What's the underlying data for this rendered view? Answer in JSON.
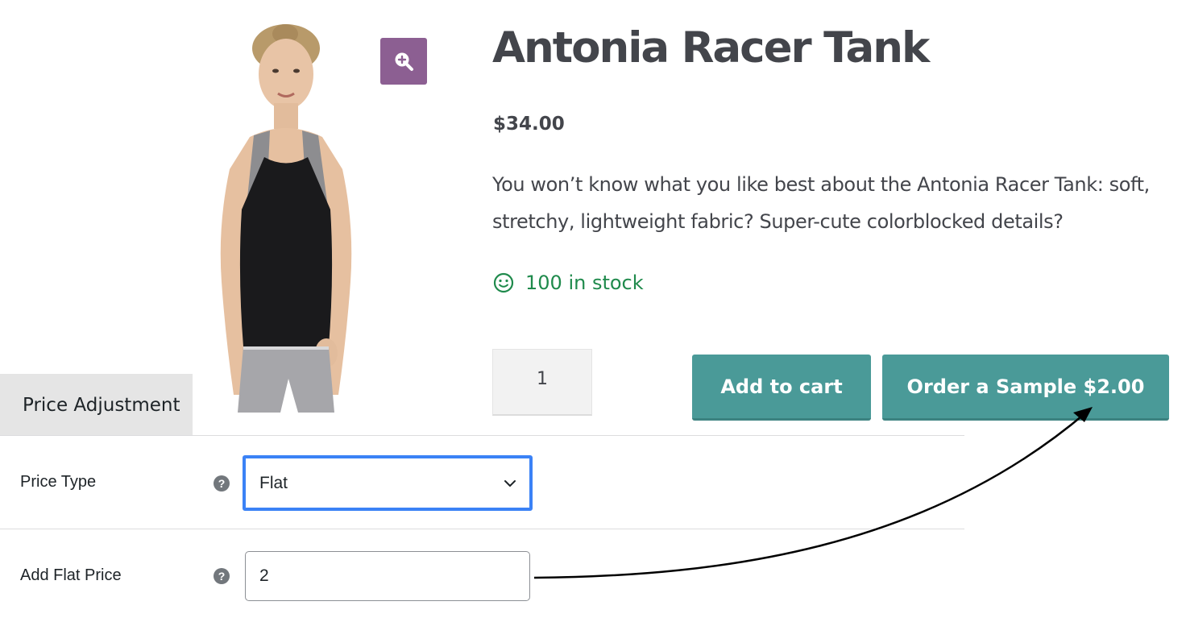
{
  "product": {
    "title": "Antonia Racer Tank",
    "price": "$34.00",
    "description": "You won’t know what you like best about the Antonia Racer Tank: soft, stretchy, lightweight fabric? Super-cute colorblocked details?",
    "stock_text": "100 in stock",
    "quantity": "1",
    "add_to_cart_label": "Add to cart",
    "order_sample_label": "Order a Sample $2.00",
    "zoom_icon": "zoom-in-icon"
  },
  "admin": {
    "tab_label": "Price Adjustment",
    "price_type_label": "Price Type",
    "price_type_value": "Flat",
    "flat_price_label": "Add Flat Price",
    "flat_price_value": "2",
    "help_icon": "question-icon"
  },
  "colors": {
    "button": "#4a9a98",
    "zoom_button": "#8c5f92",
    "stock_green": "#1f8a4c",
    "focus_blue": "#3b82f6",
    "text": "#43454b"
  }
}
